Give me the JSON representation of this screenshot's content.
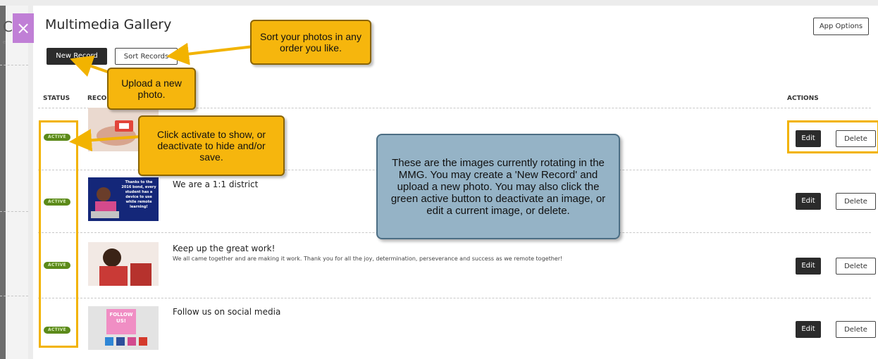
{
  "background": {
    "letter": "C",
    "sub": "e"
  },
  "close_label": "×",
  "modal": {
    "title": "Multimedia Gallery",
    "new_record": "New Record",
    "sort_records": "Sort Records",
    "app_options": "App Options"
  },
  "columns": {
    "status": "STATUS",
    "record": "RECO",
    "actions": "ACTIONS"
  },
  "records": [
    {
      "status": "ACTIVE",
      "title": "",
      "desc": "",
      "thumb_alt": "hands with red device",
      "edit": "Edit",
      "delete": "Delete"
    },
    {
      "status": "ACTIVE",
      "title": "We are a 1:1 district",
      "desc": "",
      "thumb_text": "Thanks to the 2016 bond, every student has a device to use while remote learning!",
      "edit": "Edit",
      "delete": "Delete"
    },
    {
      "status": "ACTIVE",
      "title": "Keep up the great work!",
      "desc": "We all came together and are making it work. Thank you for all the joy, determination, perseverance and success as we remote together!",
      "edit": "Edit",
      "delete": "Delete"
    },
    {
      "status": "ACTIVE",
      "title": "Follow us on social media",
      "desc": "",
      "thumb_text": "FOLLOW US!",
      "edit": "Edit",
      "delete": "Delete"
    }
  ],
  "callouts": {
    "sort": "Sort your photos in any order you like.",
    "upload": "Upload a new photo.",
    "activate": "Click activate to show, or deactivate to hide and/or save.",
    "info": "These are the images currently rotating in the MMG. You may create a 'New Record' and upload a new photo. You may also click the green active button to deactivate an image, or edit a current image, or delete."
  },
  "colors": {
    "callout": "#f6b60d",
    "info": "#95b3c6",
    "active": "#5c8a1a",
    "close": "#c07fd6"
  }
}
